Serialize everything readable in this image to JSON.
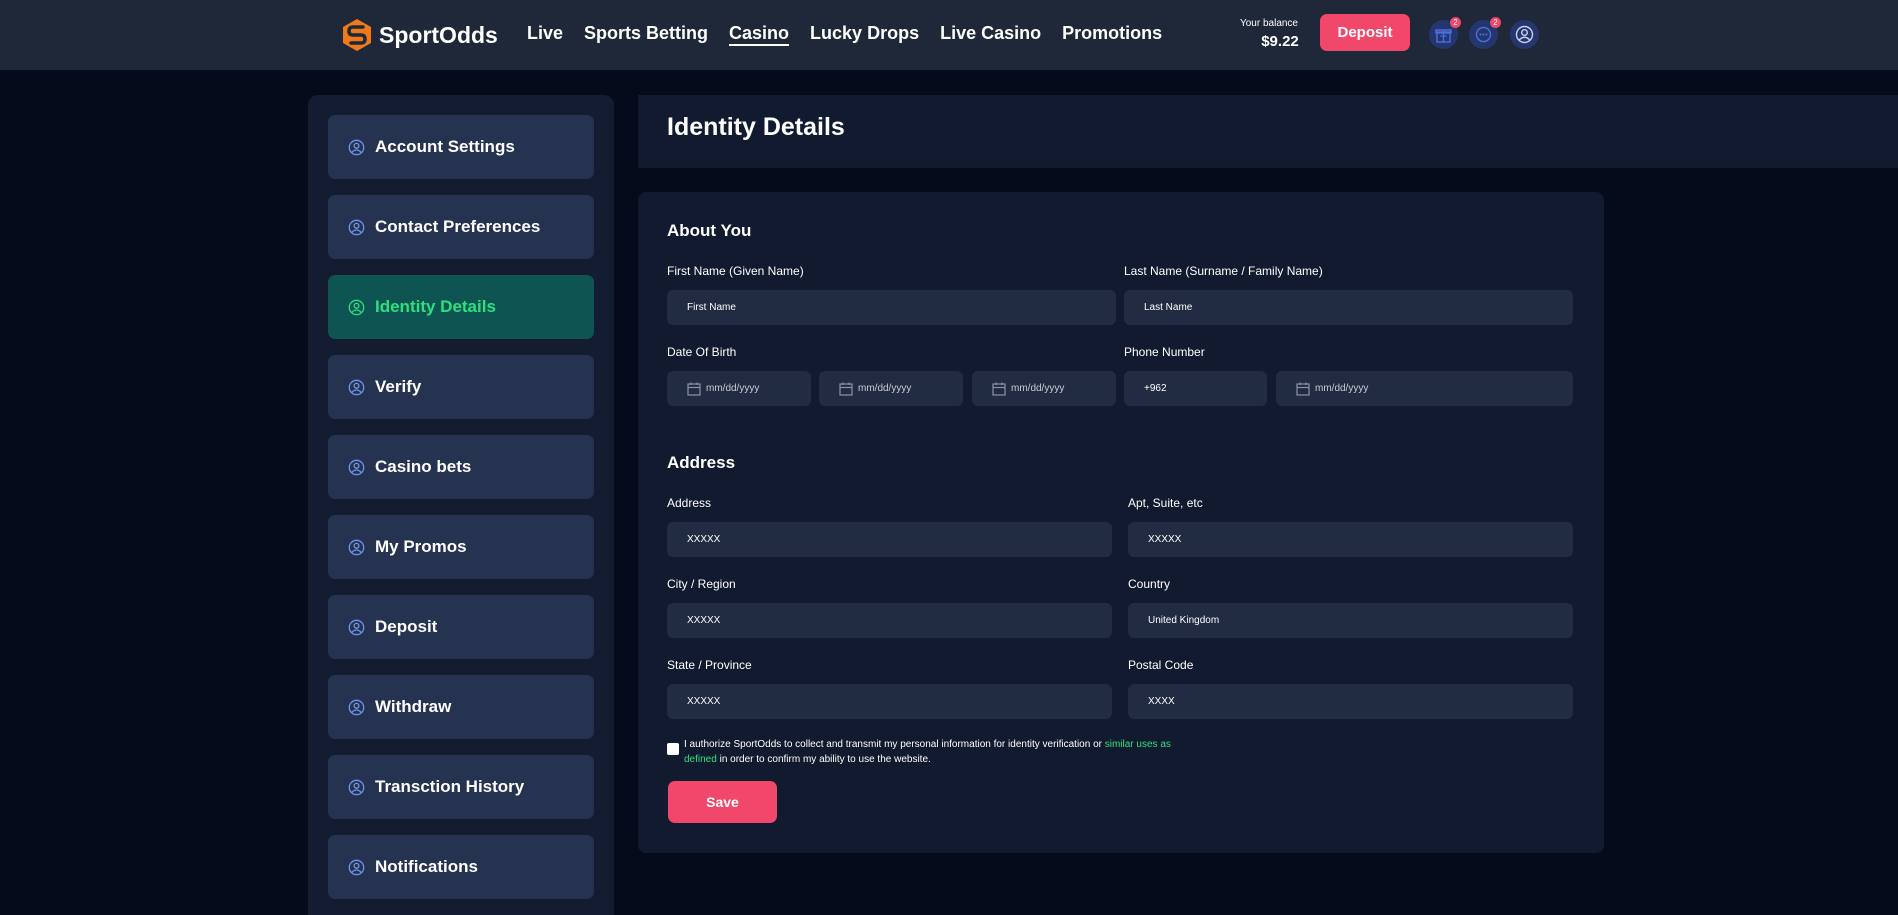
{
  "header": {
    "brand": "SportOdds",
    "nav": [
      {
        "label": "Live"
      },
      {
        "label": "Sports Betting"
      },
      {
        "label": "Casino",
        "active": true
      },
      {
        "label": "Lucky Drops"
      },
      {
        "label": "Live Casino"
      },
      {
        "label": "Promotions"
      }
    ],
    "balance_label": "Your balance",
    "balance_value": "$9.22",
    "deposit_label": "Deposit",
    "gift_badge": "2",
    "chat_badge": "2",
    "icons": [
      "gift-icon",
      "chat-icon",
      "user-icon"
    ]
  },
  "sidebar": {
    "items": [
      {
        "label": "Account Settings"
      },
      {
        "label": "Contact Preferences"
      },
      {
        "label": "Identity Details",
        "active": true
      },
      {
        "label": "Verify"
      },
      {
        "label": "Casino bets"
      },
      {
        "label": "My Promos"
      },
      {
        "label": "Deposit"
      },
      {
        "label": "Withdraw"
      },
      {
        "label": "Transction History"
      },
      {
        "label": "Notifications"
      }
    ]
  },
  "page": {
    "title": "Identity Details"
  },
  "about": {
    "title": "About You",
    "first_name_label": "First Name (Given Name)",
    "first_name_placeholder": "First Name",
    "last_name_label": "Last Name (Surname / Family Name)",
    "last_name_placeholder": "Last Name",
    "dob_label": "Date Of Birth",
    "date_placeholder": "mm/dd/yyyy",
    "phone_label": "Phone Number",
    "phone_code": "+962"
  },
  "address": {
    "title": "Address",
    "address_label": "Address",
    "address_value": "XXXXX",
    "apt_label": "Apt, Suite, etc",
    "apt_value": "XXXXX",
    "city_label": "City / Region",
    "city_value": "XXXXX",
    "country_label": "Country",
    "country_value": "United Kingdom",
    "state_label": "State / Province",
    "state_value": "XXXXX",
    "postal_label": "Postal Code",
    "postal_value": "XXXX"
  },
  "consent": {
    "text_before": "I authorize SportOdds to collect and transmit my personal information for identity verification or ",
    "link": "similar uses as defined",
    "text_after": " in order to confirm my ability to use the website."
  },
  "save_label": "Save",
  "colors": {
    "accent": "#f0476a",
    "active_green": "#2ee07d",
    "active_bg": "#0d5452",
    "header_bg": "#1f2839",
    "page_bg": "#050b1b"
  }
}
